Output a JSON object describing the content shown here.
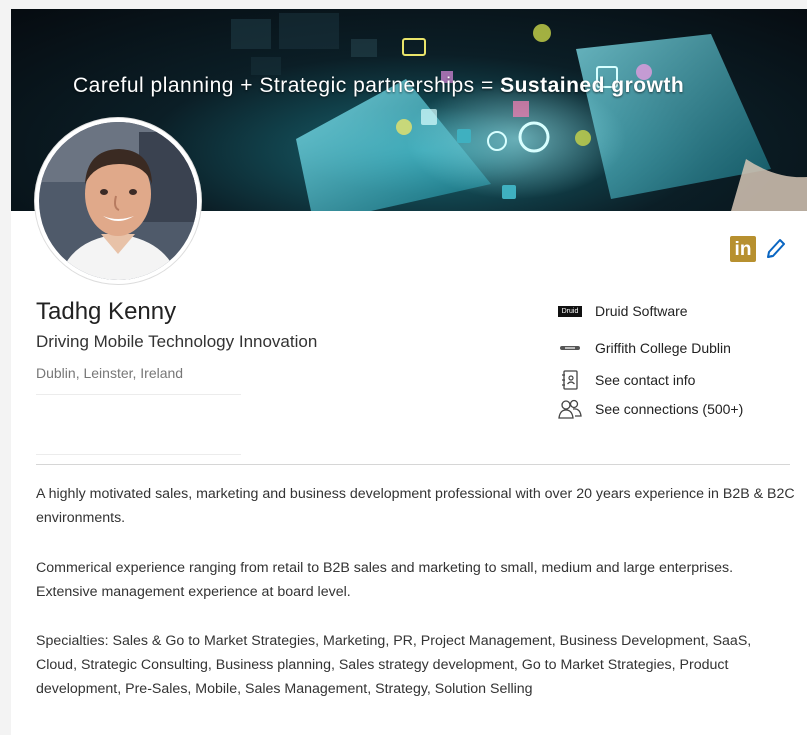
{
  "banner": {
    "tagline_prefix": "Careful planning + Strategic partnerships = ",
    "tagline_bold": "Sustained growth"
  },
  "profile": {
    "name": "Tadhg Kenny",
    "headline": "Driving Mobile Technology Innovation",
    "location": "Dublin, Leinster, Ireland"
  },
  "header_actions": {
    "linkedin_logo_text": "in",
    "linkedin_color": "#b7902f",
    "edit_icon": "pencil-icon",
    "edit_color": "#0a66c2"
  },
  "side_info": {
    "company": "Druid Software",
    "company_logo_text": "Druid",
    "company_logo_icon": "druid-logo-icon",
    "school": "Griffith College Dublin",
    "school_logo_icon": "griffith-logo-icon",
    "contact_label": "See contact info",
    "contact_icon": "address-book-icon",
    "connections_label": "See connections (500+)",
    "connections_icon": "people-icon"
  },
  "about": {
    "paragraphs": [
      "A highly motivated sales, marketing and business development professional with over 20 years experience in B2B & B2C environments.",
      "Commerical experience ranging from retail to B2B sales and marketing to small, medium and large enterprises. Extensive management experience at board level.",
      "Specialties: Sales & Go to Market Strategies, Marketing, PR, Project Management, Business Development, SaaS, Cloud, Strategic Consulting, Business planning, Sales strategy development, Go to Market Strategies, Product development, Pre-Sales, Mobile, Sales Management, Strategy, Solution Selling"
    ]
  }
}
